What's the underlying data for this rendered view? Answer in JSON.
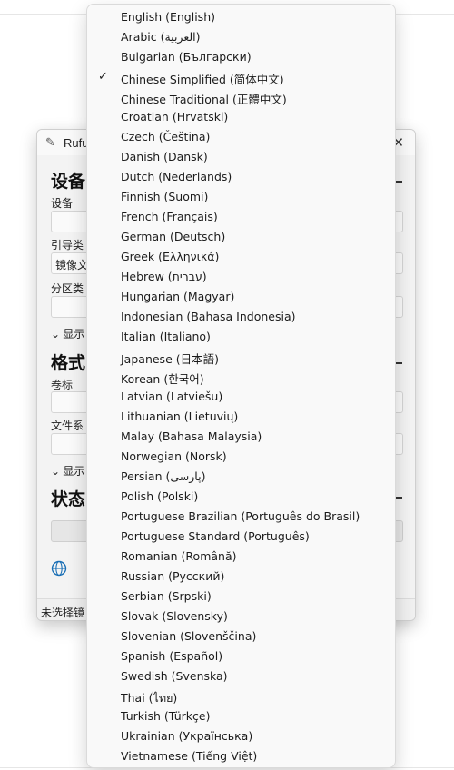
{
  "rufus": {
    "title": "Rufu",
    "sections": {
      "device": "设备",
      "format": "格式",
      "status": "状态"
    },
    "labels": {
      "device": "设备",
      "boot_type": "引导类",
      "partition": "分区类",
      "volume": "卷标",
      "filesystem": "文件系"
    },
    "boot_value": "镜像文",
    "advanced_device": "显示",
    "advanced_format": "显示",
    "status_text": "未选择镜"
  },
  "menu": {
    "selected_index": 3,
    "items": [
      "English (English)",
      "Arabic (العربية)",
      "Bulgarian (Български)",
      "Chinese Simplified (简体中文)",
      "Chinese Traditional (正體中文)",
      "Croatian (Hrvatski)",
      "Czech (Čeština)",
      "Danish (Dansk)",
      "Dutch (Nederlands)",
      "Finnish (Suomi)",
      "French (Français)",
      "German (Deutsch)",
      "Greek (Ελληνικά)",
      "Hebrew (עברית)",
      "Hungarian (Magyar)",
      "Indonesian (Bahasa Indonesia)",
      "Italian (Italiano)",
      "Japanese (日本語)",
      "Korean (한국어)",
      "Latvian (Latviešu)",
      "Lithuanian (Lietuvių)",
      "Malay (Bahasa Malaysia)",
      "Norwegian (Norsk)",
      "Persian (پارسی)",
      "Polish (Polski)",
      "Portuguese Brazilian (Português do Brasil)",
      "Portuguese Standard (Português)",
      "Romanian (Română)",
      "Russian (Русский)",
      "Serbian (Srpski)",
      "Slovak (Slovensky)",
      "Slovenian (Slovenščina)",
      "Spanish (Español)",
      "Swedish (Svenska)",
      "Thai (ไทย)",
      "Turkish (Türkçe)",
      "Ukrainian (Українська)",
      "Vietnamese (Tiếng Việt)"
    ]
  }
}
